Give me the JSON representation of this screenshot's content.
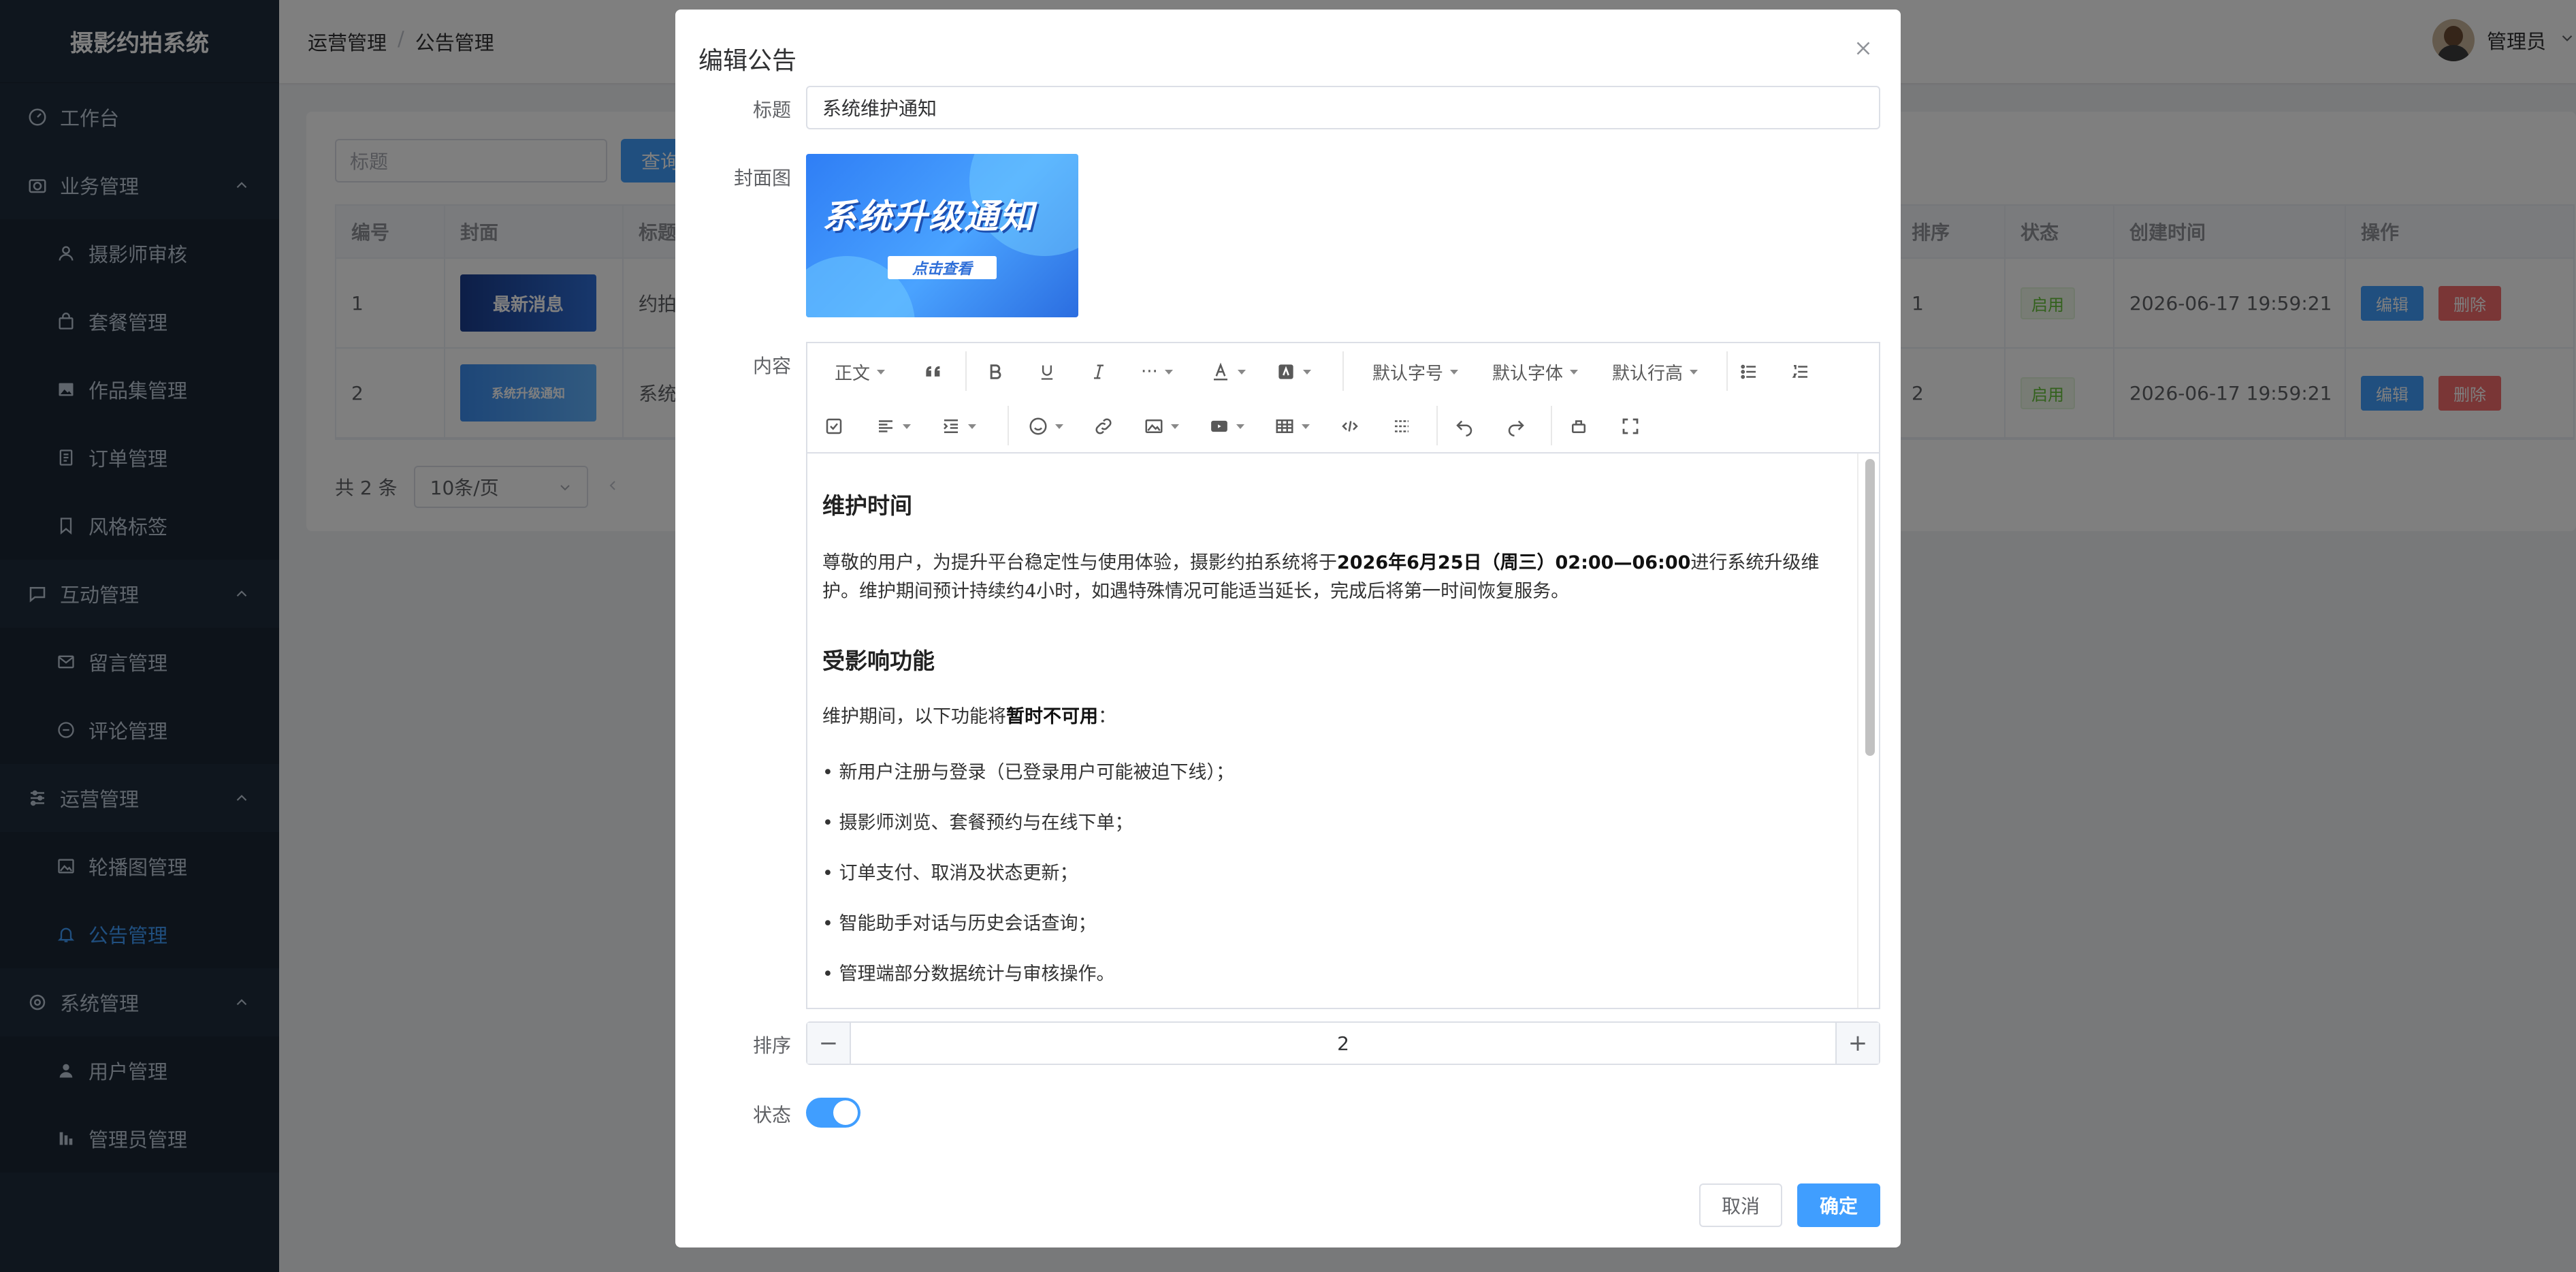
{
  "sidebar": {
    "brand": "摄影约拍系统",
    "workbench": "工作台",
    "groups": [
      {
        "label": "业务管理",
        "items": [
          "摄影师审核",
          "套餐管理",
          "作品集管理",
          "订单管理",
          "风格标签"
        ]
      },
      {
        "label": "互动管理",
        "items": [
          "留言管理",
          "评论管理"
        ]
      },
      {
        "label": "运营管理",
        "items": [
          "轮播图管理",
          "公告管理"
        ]
      },
      {
        "label": "系统管理",
        "items": [
          "用户管理",
          "管理员管理"
        ]
      }
    ]
  },
  "header": {
    "breadcrumb": [
      "运营管理",
      "公告管理"
    ],
    "user": "管理员"
  },
  "content": {
    "search_placeholder": "标题",
    "search_button": "查询",
    "columns": [
      "编号",
      "封面",
      "标题",
      "排序",
      "状态",
      "创建时间",
      "操作"
    ],
    "rows": [
      {
        "id": "1",
        "cover_text": "最新消息",
        "title": "约拍",
        "sort": "1",
        "status": "启用",
        "created": "2026-06-17 19:59:21"
      },
      {
        "id": "2",
        "cover_text": "系统升级通知",
        "title": "系统",
        "sort": "2",
        "status": "启用",
        "created": "2026-06-17 19:59:21"
      }
    ],
    "edit_label": "编辑",
    "delete_label": "删除",
    "total": "共 2 条",
    "page_size": "10条/页"
  },
  "dialog": {
    "title": "编辑公告",
    "fields": {
      "title_label": "标题",
      "title_value": "系统维护通知",
      "cover_label": "封面图",
      "cover_title": "系统升级通知",
      "cover_button": "点击查看",
      "content_label": "内容",
      "sort_label": "排序",
      "sort_value": "2",
      "status_label": "状态",
      "status_on": true
    },
    "toolbar": {
      "paragraph": "正文",
      "more": "···",
      "font_size": "默认字号",
      "font_family": "默认字体",
      "line_height": "默认行高"
    },
    "body": {
      "h1": "维护时间",
      "p1_a": "尊敬的用户，为提升平台稳定性与使用体验，摄影约拍系统将于",
      "p1_b": "2026年6月25日（周三）02:00—06:00",
      "p1_c": "进行系统升级维",
      "p1_d": "护。维护期间预计持续约4小时，如遇特殊情况可能适当延长，完成后将第一时间恢复服务。",
      "h2": "受影响功能",
      "p2_a": "维护期间，以下功能将",
      "p2_b": "暂时不可用",
      "p2_c": "：",
      "bullets": [
        "• 新用户注册与登录（已登录用户可能被迫下线）；",
        "• 摄影师浏览、套餐预约与在线下单；",
        "• 订单支付、取消及状态更新；",
        "• 智能助手对话与历史会话查询；",
        "• 管理端部分数据统计与审核操作。"
      ]
    },
    "cancel": "取消",
    "confirm": "确定"
  },
  "colors": {
    "primary": "#409eff",
    "danger": "#f56c6c",
    "success": "#67c23a",
    "sidebar": "#1f2d3d"
  }
}
